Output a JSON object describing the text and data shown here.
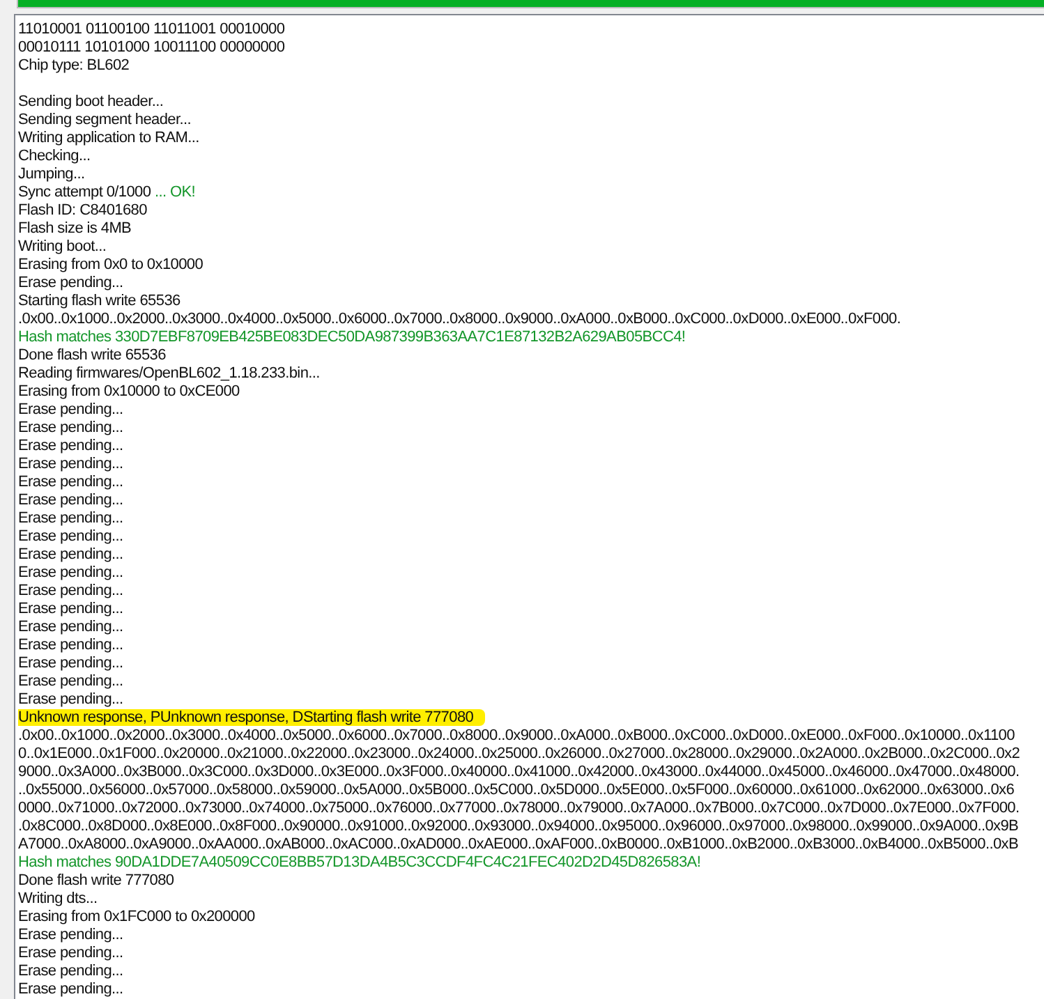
{
  "progress": {
    "level": 1
  },
  "log": {
    "lines": [
      {
        "kind": "plain",
        "text": "11010001 01100100 11011001 00010000"
      },
      {
        "kind": "plain",
        "text": "00010111 10101000 10011100 00000000"
      },
      {
        "kind": "plain",
        "text": "Chip type: BL602"
      },
      {
        "kind": "blank"
      },
      {
        "kind": "plain",
        "text": "Sending boot header..."
      },
      {
        "kind": "plain",
        "text": "Sending segment header..."
      },
      {
        "kind": "plain",
        "text": "Writing application to RAM..."
      },
      {
        "kind": "plain",
        "text": "Checking..."
      },
      {
        "kind": "plain",
        "text": "Jumping..."
      },
      {
        "kind": "plain",
        "text": "Sync attempt 0/1000",
        "suffix": " ... OK!"
      },
      {
        "kind": "plain",
        "text": "Flash ID: C8401680"
      },
      {
        "kind": "plain",
        "text": "Flash size is 4MB"
      },
      {
        "kind": "plain",
        "text": "Writing boot..."
      },
      {
        "kind": "plain",
        "text": "Erasing from 0x0 to 0x10000"
      },
      {
        "kind": "plain",
        "text": "Erase pending..."
      },
      {
        "kind": "plain",
        "text": "Starting flash write 65536"
      },
      {
        "kind": "plain",
        "text": ".0x00..0x1000..0x2000..0x3000..0x4000..0x5000..0x6000..0x7000..0x8000..0x9000..0xA000..0xB000..0xC000..0xD000..0xE000..0xF000."
      },
      {
        "kind": "success",
        "text": "Hash matches 330D7EBF8709EB425BE083DEC50DA987399B363AA7C1E87132B2A629AB05BCC4!"
      },
      {
        "kind": "plain",
        "text": "Done flash write 65536"
      },
      {
        "kind": "plain",
        "text": "Reading firmwares/OpenBL602_1.18.233.bin..."
      },
      {
        "kind": "plain",
        "text": "Erasing from 0x10000 to 0xCE000"
      },
      {
        "kind": "plain",
        "text": "Erase pending..."
      },
      {
        "kind": "plain",
        "text": "Erase pending..."
      },
      {
        "kind": "plain",
        "text": "Erase pending..."
      },
      {
        "kind": "plain",
        "text": "Erase pending..."
      },
      {
        "kind": "plain",
        "text": "Erase pending..."
      },
      {
        "kind": "plain",
        "text": "Erase pending..."
      },
      {
        "kind": "plain",
        "text": "Erase pending..."
      },
      {
        "kind": "plain",
        "text": "Erase pending..."
      },
      {
        "kind": "plain",
        "text": "Erase pending..."
      },
      {
        "kind": "plain",
        "text": "Erase pending..."
      },
      {
        "kind": "plain",
        "text": "Erase pending..."
      },
      {
        "kind": "plain",
        "text": "Erase pending..."
      },
      {
        "kind": "plain",
        "text": "Erase pending..."
      },
      {
        "kind": "plain",
        "text": "Erase pending..."
      },
      {
        "kind": "plain",
        "text": "Erase pending..."
      },
      {
        "kind": "plain",
        "text": "Erase pending..."
      },
      {
        "kind": "plain",
        "text": "Erase pending..."
      },
      {
        "kind": "highlight",
        "text": "Unknown response, PUnknown response, DStarting flash write 777080"
      },
      {
        "kind": "plain",
        "text": ".0x00..0x1000..0x2000..0x3000..0x4000..0x5000..0x6000..0x7000..0x8000..0x9000..0xA000..0xB000..0xC000..0xD000..0xE000..0xF000..0x10000..0x1100"
      },
      {
        "kind": "plain",
        "text": "0..0x1E000..0x1F000..0x20000..0x21000..0x22000..0x23000..0x24000..0x25000..0x26000..0x27000..0x28000..0x29000..0x2A000..0x2B000..0x2C000..0x2"
      },
      {
        "kind": "plain",
        "text": "9000..0x3A000..0x3B000..0x3C000..0x3D000..0x3E000..0x3F000..0x40000..0x41000..0x42000..0x43000..0x44000..0x45000..0x46000..0x47000..0x48000."
      },
      {
        "kind": "plain",
        "text": "..0x55000..0x56000..0x57000..0x58000..0x59000..0x5A000..0x5B000..0x5C000..0x5D000..0x5E000..0x5F000..0x60000..0x61000..0x62000..0x63000..0x6"
      },
      {
        "kind": "plain",
        "text": "0000..0x71000..0x72000..0x73000..0x74000..0x75000..0x76000..0x77000..0x78000..0x79000..0x7A000..0x7B000..0x7C000..0x7D000..0x7E000..0x7F000."
      },
      {
        "kind": "plain",
        "text": ".0x8C000..0x8D000..0x8E000..0x8F000..0x90000..0x91000..0x92000..0x93000..0x94000..0x95000..0x96000..0x97000..0x98000..0x99000..0x9A000..0x9B"
      },
      {
        "kind": "plain",
        "text": "A7000..0xA8000..0xA9000..0xAA000..0xAB000..0xAC000..0xAD000..0xAE000..0xAF000..0xB0000..0xB1000..0xB2000..0xB3000..0xB4000..0xB5000..0xB"
      },
      {
        "kind": "success",
        "text": "Hash matches 90DA1DDE7A40509CC0E8BB57D13DA4B5C3CCDF4FC4C21FEC402D2D45D826583A!"
      },
      {
        "kind": "plain",
        "text": "Done flash write 777080"
      },
      {
        "kind": "plain",
        "text": "Writing dts..."
      },
      {
        "kind": "plain",
        "text": "Erasing from 0x1FC000 to 0x200000"
      },
      {
        "kind": "plain",
        "text": "Erase pending..."
      },
      {
        "kind": "plain",
        "text": "Erase pending..."
      },
      {
        "kind": "plain",
        "text": "Erase pending..."
      },
      {
        "kind": "plain",
        "text": "Erase pending..."
      }
    ]
  }
}
